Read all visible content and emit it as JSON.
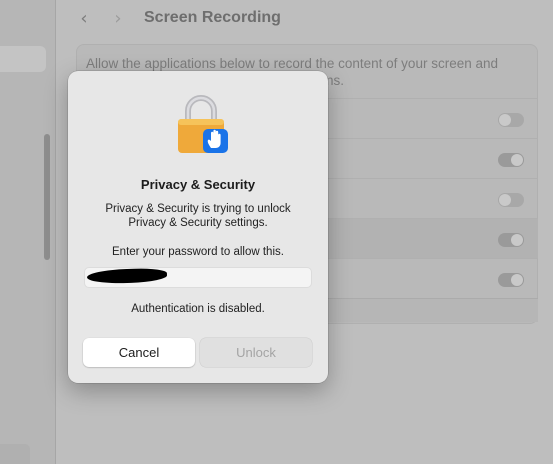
{
  "window": {
    "page_title": "Screen Recording",
    "nav_back_icon": "chevron-left-icon",
    "nav_forward_icon": "chevron-right-icon"
  },
  "content": {
    "description": "Allow the applications below to record the content of your screen and",
    "description_tail": "ns.",
    "rows": [
      {
        "toggle": "off"
      },
      {
        "toggle": "on"
      },
      {
        "toggle": "off"
      },
      {
        "toggle": "on"
      },
      {
        "toggle": "on"
      }
    ]
  },
  "dialog": {
    "icon": "lock-with-hand-icon",
    "title": "Privacy & Security",
    "message": "Privacy & Security is trying to unlock Privacy & Security settings.",
    "prompt": "Enter your password to allow this.",
    "password_value": "",
    "status": "Authentication is disabled.",
    "cancel_label": "Cancel",
    "unlock_label": "Unlock"
  },
  "colors": {
    "dialog_bg": "#e7e7e7",
    "lock_gold": "#f0b13a",
    "badge_blue": "#1a73e8"
  }
}
